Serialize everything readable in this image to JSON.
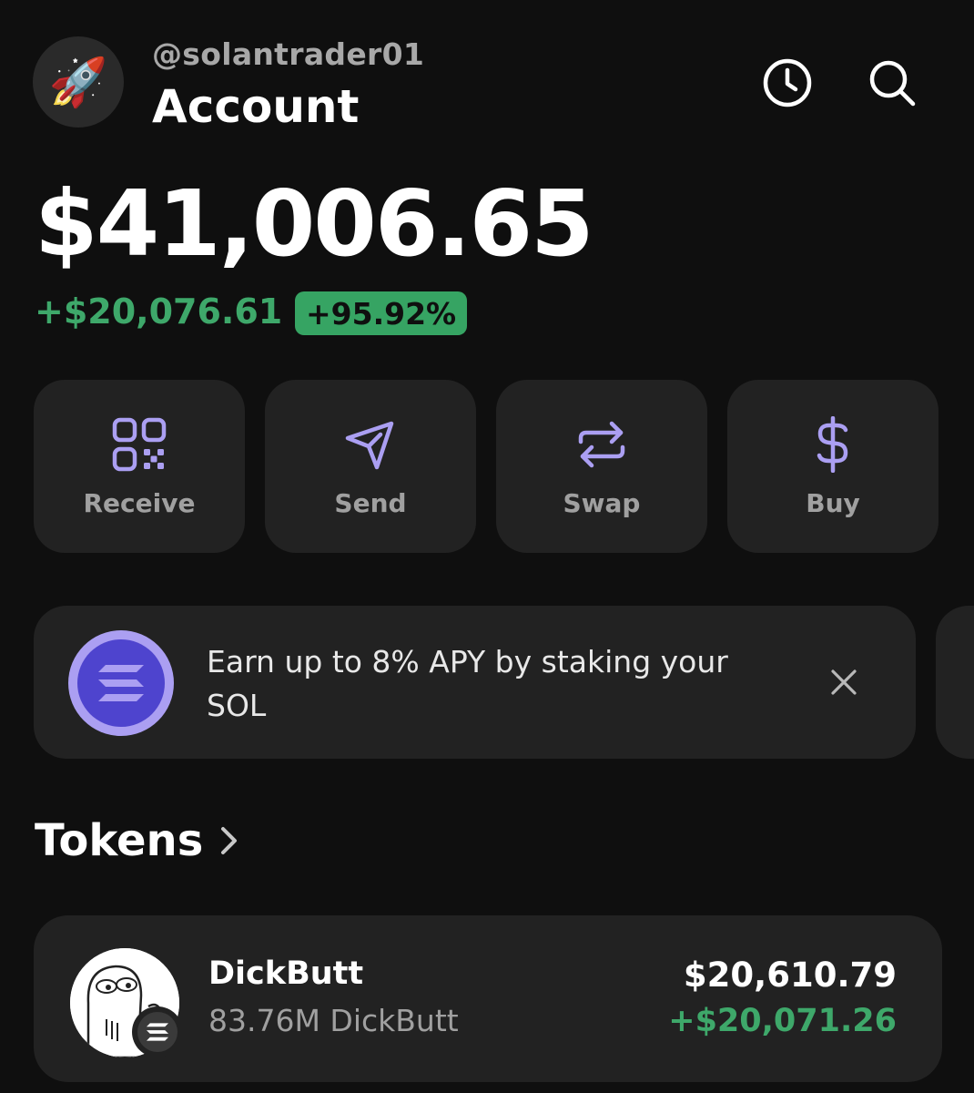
{
  "header": {
    "avatar_emoji": "🚀",
    "username": "@solantrader01",
    "title": "Account",
    "icons": [
      "history-icon",
      "search-icon"
    ]
  },
  "balance": {
    "total": "$41,006.65",
    "change_amount": "+$20,076.61",
    "change_percent": "+95.92%"
  },
  "actions": [
    {
      "label": "Receive",
      "icon": "qr-code-icon"
    },
    {
      "label": "Send",
      "icon": "send-icon"
    },
    {
      "label": "Swap",
      "icon": "swap-icon"
    },
    {
      "label": "Buy",
      "icon": "dollar-icon"
    }
  ],
  "banner": {
    "text": "Earn up to 8% APY by staking your SOL",
    "icon": "solana-icon"
  },
  "tokens": {
    "heading": "Tokens",
    "items": [
      {
        "name": "DickButt",
        "amount": "83.76M DickButt",
        "value": "$20,610.79",
        "change": "+$20,071.26"
      }
    ]
  },
  "colors": {
    "background": "#0f0f0f",
    "card": "#222222",
    "accent_purple": "#ab9ff2",
    "positive_green": "#3ea86a"
  }
}
